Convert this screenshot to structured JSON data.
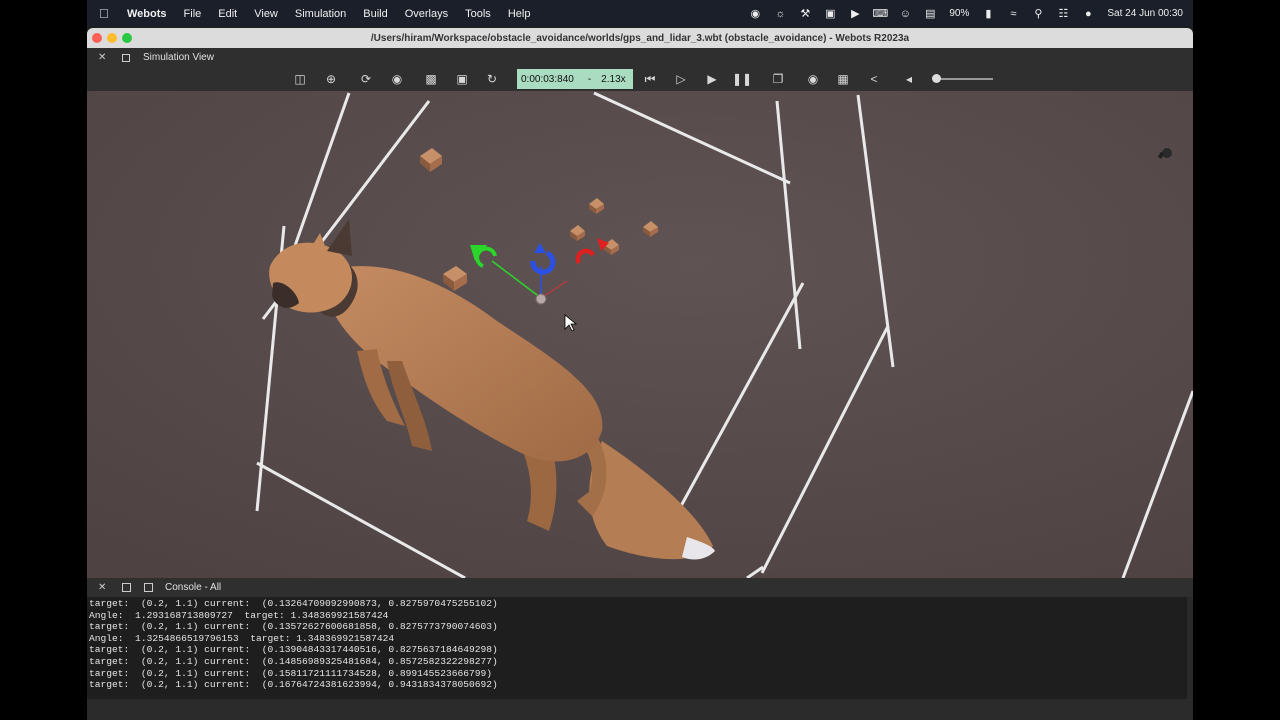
{
  "menubar": {
    "items": [
      "Webots",
      "File",
      "Edit",
      "View",
      "Simulation",
      "Build",
      "Overlays",
      "Tools",
      "Help"
    ],
    "battery": "90%",
    "datetime": "Sat 24 Jun  00:30"
  },
  "window": {
    "title": "/Users/hiram/Workspace/obstacle_avoidance/worlds/gps_and_lidar_3.wbt (obstacle_avoidance) - Webots R2023a"
  },
  "simview": {
    "title": "Simulation View",
    "time": "0:00:03:840",
    "speed_sep": "-",
    "speed": "2.13x"
  },
  "console": {
    "title": "Console - All",
    "lines": [
      "target:  (0.2, 1.1) current:  (0.13264709092990873, 0.8275970475255102)",
      "Angle:  1.293168713809727  target: 1.348369921587424",
      "target:  (0.2, 1.1) current:  (0.13572627600681858, 0.8275773790074603)",
      "Angle:  1.3254866519796153  target: 1.348369921587424",
      "target:  (0.2, 1.1) current:  (0.13904843317440516, 0.8275637184649298)",
      "target:  (0.2, 1.1) current:  (0.14856989325481684, 0.8572582322298277)",
      "target:  (0.2, 1.1) current:  (0.15811721111734528, 0.899145523666799)",
      "target:  (0.2, 1.1) current:  (0.16764724381623994, 0.9431834378050692)"
    ]
  },
  "colors": {
    "viewport_bg": "#5a4e4e",
    "time_box_bg": "#a9dcc0",
    "fox": "#b9815a"
  }
}
